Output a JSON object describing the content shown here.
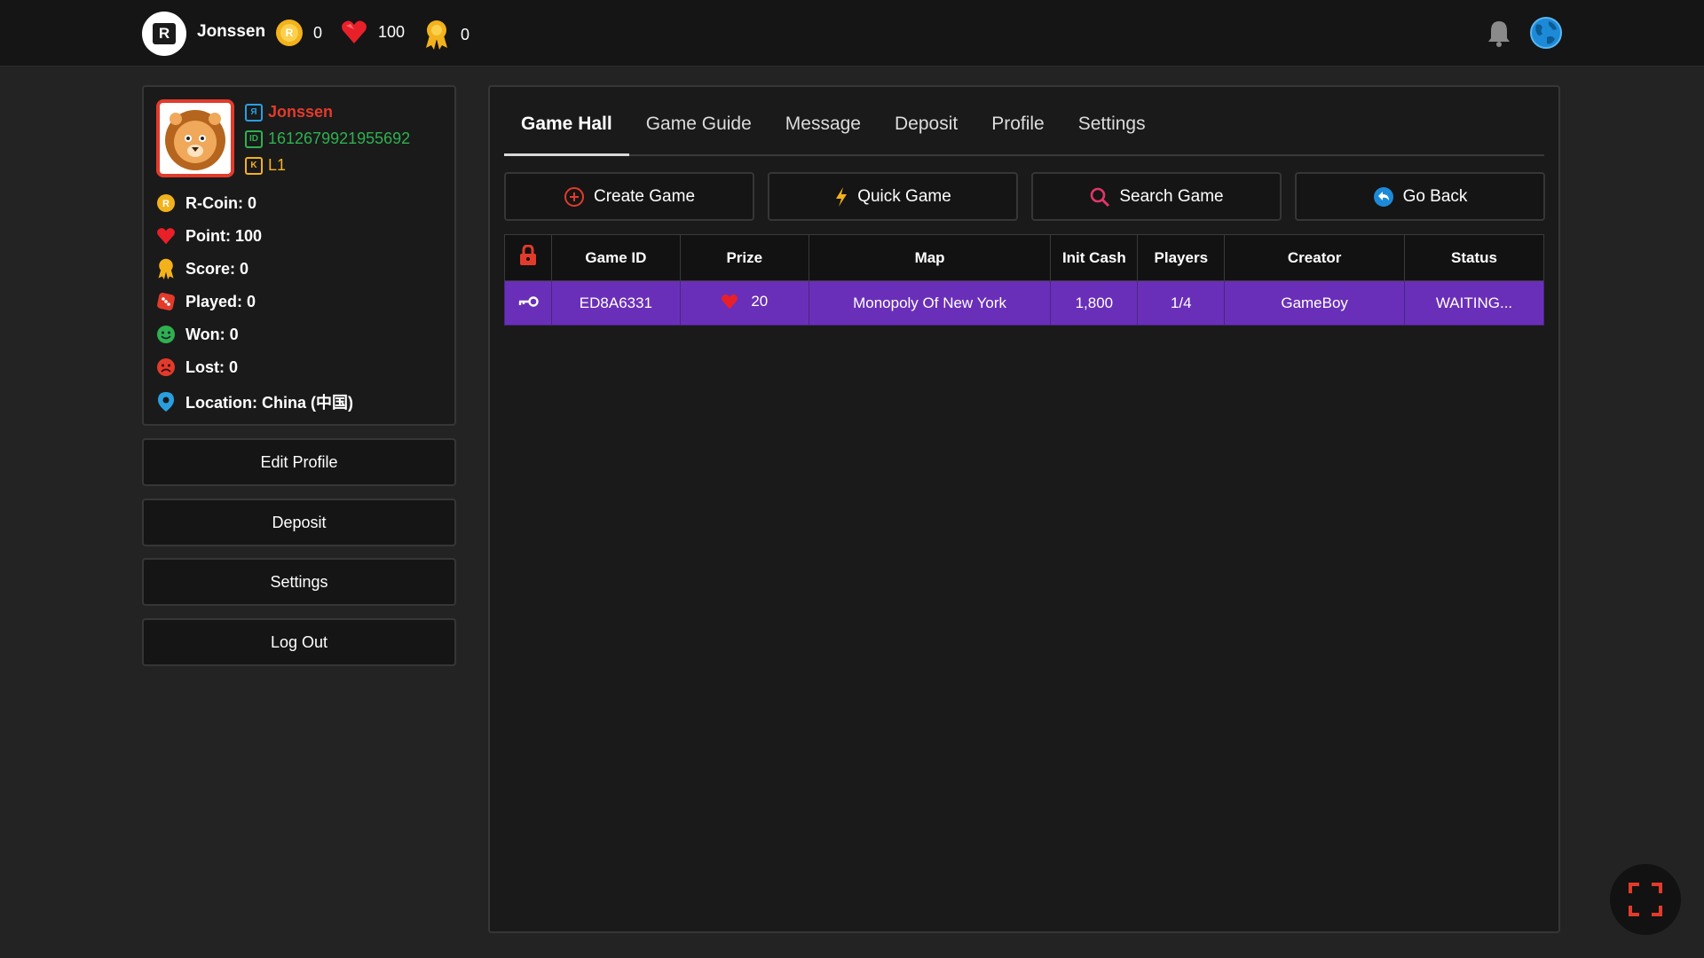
{
  "topbar": {
    "brand_letter": "R",
    "username": "Jonssen",
    "rcoin": "0",
    "points": "100",
    "score": "0",
    "coin_letter": "R"
  },
  "profile": {
    "name": "Jonssen",
    "user_id": "1612679921955692",
    "level": "L1",
    "stats": {
      "rcoin": "R-Coin: 0",
      "point": "Point: 100",
      "score": "Score: 0",
      "played": "Played: 0",
      "won": "Won: 0",
      "lost": "Lost: 0",
      "location": "Location: China (中国)"
    }
  },
  "sidebar": {
    "edit_profile": "Edit Profile",
    "deposit": "Deposit",
    "settings": "Settings",
    "log_out": "Log Out"
  },
  "tabs": [
    "Game Hall",
    "Game Guide",
    "Message",
    "Deposit",
    "Profile",
    "Settings"
  ],
  "actions": {
    "create": "Create Game",
    "quick": "Quick Game",
    "search": "Search Game",
    "back": "Go Back"
  },
  "table": {
    "headers": [
      "Game ID",
      "Prize",
      "Map",
      "Init Cash",
      "Players",
      "Creator",
      "Status"
    ],
    "rows": [
      {
        "game_id": "ED8A6331",
        "prize": "20",
        "map": "Monopoly Of New York",
        "init_cash": "1,800",
        "players": "1/4",
        "creator": "GameBoy",
        "status": "WAITING..."
      }
    ]
  },
  "colors": {
    "accent_red": "#e23b2c",
    "row_purple": "#6a2fb8",
    "gold": "#f3b21c",
    "id_green": "#2fb14f",
    "name_blue": "#2a9fe0"
  },
  "icons": [
    "bell-icon",
    "globe-icon",
    "lock-icon",
    "key-icon",
    "fullscreen-icon"
  ]
}
